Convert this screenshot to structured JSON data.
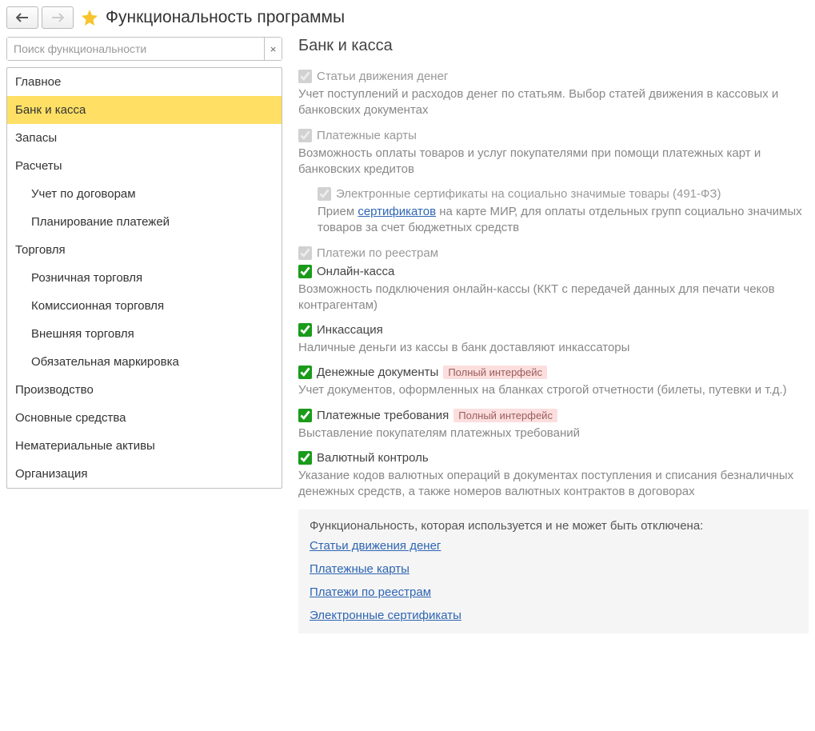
{
  "page_title": "Функциональность программы",
  "search": {
    "placeholder": "Поиск функциональности",
    "clear": "×"
  },
  "nav": {
    "items": [
      {
        "label": "Главное",
        "child": false,
        "active": false
      },
      {
        "label": "Банк и касса",
        "child": false,
        "active": true
      },
      {
        "label": "Запасы",
        "child": false,
        "active": false
      },
      {
        "label": "Расчеты",
        "child": false,
        "active": false
      },
      {
        "label": "Учет по договорам",
        "child": true,
        "active": false
      },
      {
        "label": "Планирование платежей",
        "child": true,
        "active": false
      },
      {
        "label": "Торговля",
        "child": false,
        "active": false
      },
      {
        "label": "Розничная торговля",
        "child": true,
        "active": false
      },
      {
        "label": "Комиссионная торговля",
        "child": true,
        "active": false
      },
      {
        "label": "Внешняя торговля",
        "child": true,
        "active": false
      },
      {
        "label": "Обязательная маркировка",
        "child": true,
        "active": false
      },
      {
        "label": "Производство",
        "child": false,
        "active": false
      },
      {
        "label": "Основные средства",
        "child": false,
        "active": false
      },
      {
        "label": "Нематериальные активы",
        "child": false,
        "active": false
      },
      {
        "label": "Организация",
        "child": false,
        "active": false
      }
    ]
  },
  "content": {
    "title": "Банк и касса",
    "options": [
      {
        "label": "Статьи движения денег",
        "locked": true,
        "checked": true,
        "desc": "Учет поступлений и расходов денег по статьям.\nВыбор статей движения в кассовых и банковских документах"
      },
      {
        "label": "Платежные карты",
        "locked": true,
        "checked": true,
        "desc": "Возможность оплаты товаров и услуг покупателями при помощи платежных карт и банковских кредитов"
      },
      {
        "label": "Электронные сертификаты на социально значимые товары (491-ФЗ)",
        "locked": true,
        "checked": true,
        "indent": true,
        "desc_prefix": "Прием ",
        "link": "сертификатов",
        "desc_suffix": " на карте МИР, для оплаты отдельных групп социально значимых товаров за счет бюджетных средств"
      },
      {
        "label": "Платежи по реестрам",
        "locked": true,
        "checked": true
      },
      {
        "label": "Онлайн-касса",
        "locked": false,
        "checked": true,
        "desc": "Возможность подключения онлайн-кассы (ККТ с передачей данных для печати чеков контрагентам)"
      },
      {
        "label": "Инкассация",
        "locked": false,
        "checked": true,
        "desc": "Наличные деньги из кассы в банк доставляют инкассаторы"
      },
      {
        "label": "Денежные документы",
        "locked": false,
        "checked": true,
        "badge": "Полный интерфейс",
        "desc": "Учет документов, оформленных на бланках строгой отчетности (билеты, путевки и т.д.)"
      },
      {
        "label": "Платежные требования",
        "locked": false,
        "checked": true,
        "badge": "Полный интерфейс",
        "desc": "Выставление покупателям платежных требований"
      },
      {
        "label": "Валютный контроль",
        "locked": false,
        "checked": true,
        "desc": "Указание кодов валютных операций в документах поступления и списания безналичных денежных средств, а также номеров валютных контрактов в договорах"
      }
    ],
    "footer": {
      "title": "Функциональность, которая используется и не может быть отключена:",
      "links": [
        "Статьи движения денег",
        "Платежные карты",
        "Платежи по реестрам",
        "Электронные сертификаты"
      ]
    }
  }
}
